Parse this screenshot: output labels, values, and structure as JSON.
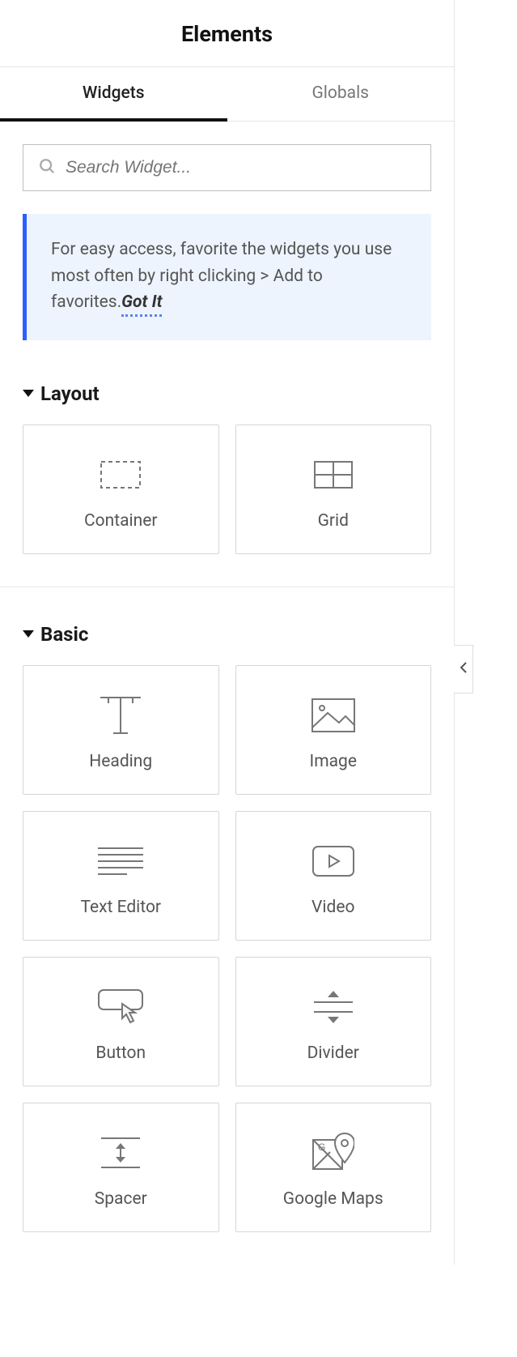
{
  "header": {
    "title": "Elements"
  },
  "tabs": {
    "widgets": "Widgets",
    "globals": "Globals"
  },
  "search": {
    "placeholder": "Search Widget..."
  },
  "tip": {
    "text": "For easy access, favorite the widgets you use most often by right clicking > Add to favorites.",
    "action": "Got It"
  },
  "sections": {
    "layout": {
      "title": "Layout",
      "items": [
        {
          "label": "Container"
        },
        {
          "label": "Grid"
        }
      ]
    },
    "basic": {
      "title": "Basic",
      "items": [
        {
          "label": "Heading"
        },
        {
          "label": "Image"
        },
        {
          "label": "Text Editor"
        },
        {
          "label": "Video"
        },
        {
          "label": "Button"
        },
        {
          "label": "Divider"
        },
        {
          "label": "Spacer"
        },
        {
          "label": "Google Maps"
        }
      ]
    }
  }
}
